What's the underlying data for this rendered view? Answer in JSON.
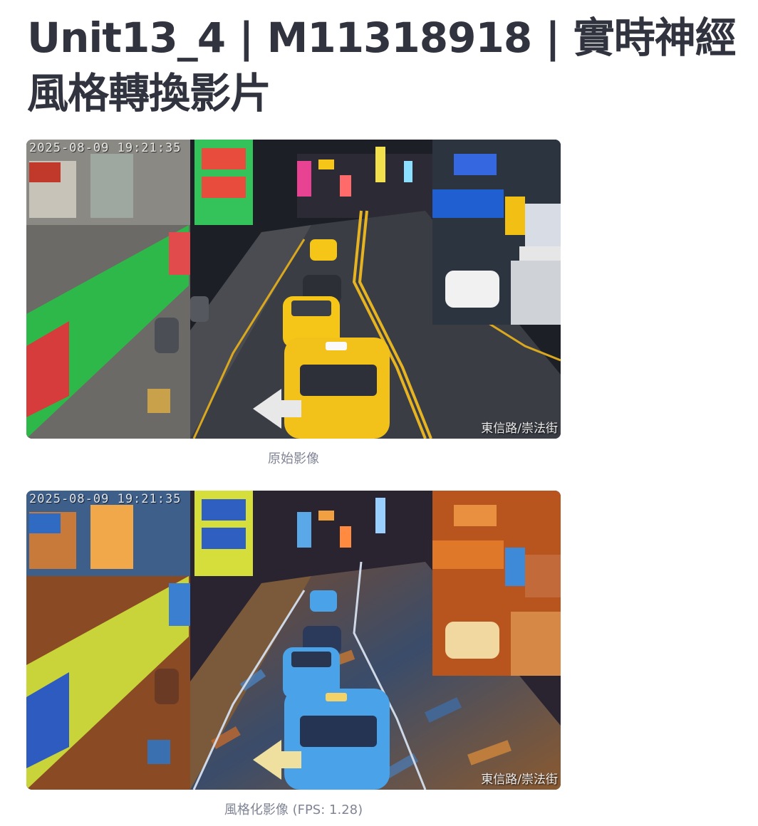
{
  "page": {
    "title": "Unit13_4 | M11318918 | 實時神經風格轉換影片"
  },
  "original": {
    "caption": "原始影像",
    "timestamp": "2025-08-09 19:21:35",
    "location": "東信路/崇法街"
  },
  "stylized": {
    "caption": "風格化影像 (FPS: 1.28)",
    "timestamp": "2025-08-09 19:21:35",
    "location": "東信路/崇法街"
  },
  "colors": {
    "title_text": "#31333f",
    "caption_text": "#808495",
    "taxi_yellow": "#f5c518",
    "stylized_taxi_blue": "#4aa3e8",
    "shop_green": "#2fb84a",
    "road_dark": "#3a3d44"
  }
}
